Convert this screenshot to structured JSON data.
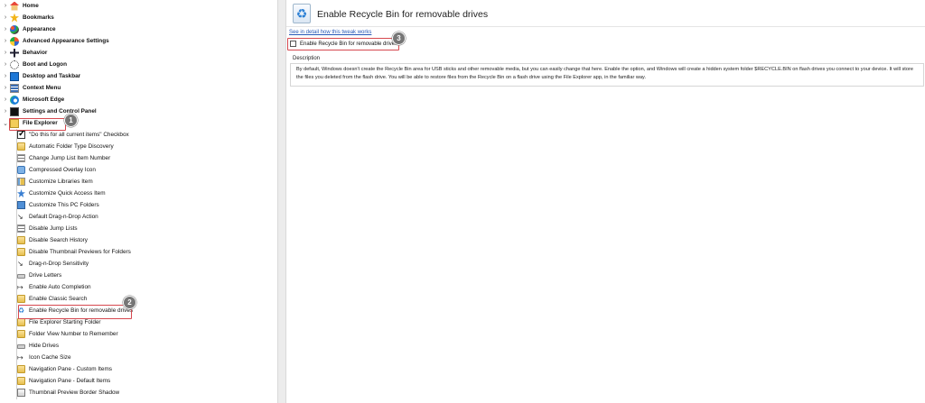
{
  "tree": {
    "roots": [
      {
        "label": "Home",
        "icon": "home-icon"
      },
      {
        "label": "Bookmarks",
        "icon": "star-icon"
      },
      {
        "label": "Appearance",
        "icon": "palette-icon"
      },
      {
        "label": "Advanced Appearance Settings",
        "icon": "advanced-appearance-icon"
      },
      {
        "label": "Behavior",
        "icon": "behavior-icon"
      },
      {
        "label": "Boot and Logon",
        "icon": "boot-icon"
      },
      {
        "label": "Desktop and Taskbar",
        "icon": "desktop-icon"
      },
      {
        "label": "Context Menu",
        "icon": "context-menu-icon"
      },
      {
        "label": "Microsoft Edge",
        "icon": "edge-icon"
      },
      {
        "label": "Settings and Control Panel",
        "icon": "control-panel-icon"
      },
      {
        "label": "File Explorer",
        "icon": "file-explorer-icon"
      }
    ],
    "children": [
      {
        "label": "\"Do this for all current items\" Checkbox",
        "icon": "checkbox-icon"
      },
      {
        "label": "Automatic Folder Type Discovery",
        "icon": "folder-icon"
      },
      {
        "label": "Change Jump List Item Number",
        "icon": "list-icon"
      },
      {
        "label": "Compressed Overlay Icon",
        "icon": "overlay-icon"
      },
      {
        "label": "Customize Libraries Item",
        "icon": "libraries-icon"
      },
      {
        "label": "Customize Quick Access Item",
        "icon": "quick-access-icon"
      },
      {
        "label": "Customize This PC Folders",
        "icon": "this-pc-icon"
      },
      {
        "label": "Default Drag-n-Drop Action",
        "icon": "arrow-icon"
      },
      {
        "label": "Disable Jump Lists",
        "icon": "list-icon"
      },
      {
        "label": "Disable Search History",
        "icon": "folder-icon"
      },
      {
        "label": "Disable Thumbnail Previews for Folders",
        "icon": "folder-icon"
      },
      {
        "label": "Drag-n-Drop Sensitivity",
        "icon": "arrow-icon"
      },
      {
        "label": "Drive Letters",
        "icon": "drive-icon"
      },
      {
        "label": "Enable Auto Completion",
        "icon": "arrow-icon"
      },
      {
        "label": "Enable Classic Search",
        "icon": "folder-icon"
      },
      {
        "label": "Enable Recycle Bin for removable drives",
        "icon": "recycle-bin-icon"
      },
      {
        "label": "File Explorer Starting Folder",
        "icon": "folder-icon"
      },
      {
        "label": "Folder View Number to Remember",
        "icon": "folder-icon"
      },
      {
        "label": "Hide Drives",
        "icon": "drive-icon"
      },
      {
        "label": "Icon Cache Size",
        "icon": "arrow-icon"
      },
      {
        "label": "Navigation Pane - Custom Items",
        "icon": "folder-icon"
      },
      {
        "label": "Navigation Pane - Default Items",
        "icon": "folder-icon"
      },
      {
        "label": "Thumbnail Preview Border Shadow",
        "icon": "thumbnail-icon"
      }
    ]
  },
  "badges": {
    "one": "1",
    "two": "2",
    "three": "3"
  },
  "content": {
    "title": "Enable Recycle Bin for removable drives",
    "detail_link": "See in detail how this tweak works",
    "option_label": "Enable Recycle Bin for removable drives",
    "description_label": "Description",
    "description": "By default, Windows doesn't create the Recycle Bin area for USB sticks and other removable media, but you can easily change that here. Enable the option, and Windows will create a hidden system folder $RECYCLE.BIN on flash drives you connect to your device. It will store the files you deleted from the flash drive. You will be able to restore files from the Recycle Bin on a flash drive using the File Explorer app, in the familiar way."
  },
  "colors": {
    "highlight": "#d6484f",
    "badge": "#767676",
    "link": "#2759b8"
  }
}
